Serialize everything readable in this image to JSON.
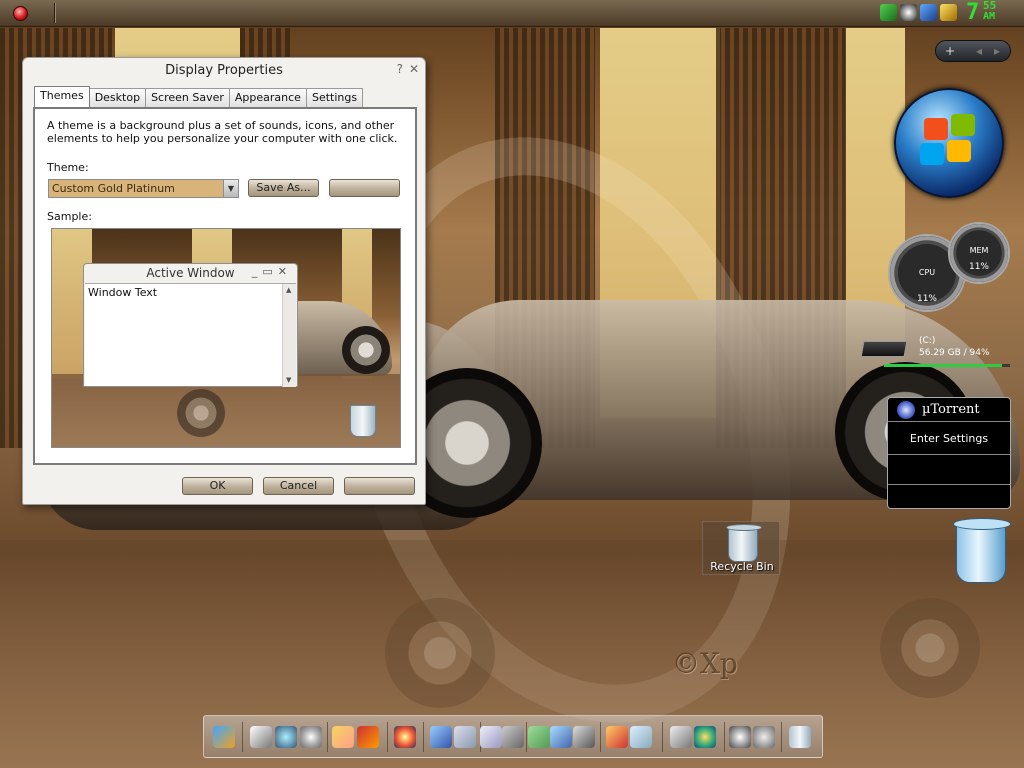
{
  "window": {
    "title": "Display Properties",
    "help": "?",
    "close": "✕"
  },
  "tabs": [
    {
      "label": "Themes"
    },
    {
      "label": "Desktop"
    },
    {
      "label": "Screen Saver"
    },
    {
      "label": "Appearance"
    },
    {
      "label": "Settings"
    }
  ],
  "themes": {
    "description": "A theme is a background plus a set of sounds, icons, and other elements to help you personalize your computer with one click.",
    "theme_label": "Theme:",
    "theme_value": "Custom Gold Platinum",
    "save_as": "Save As...",
    "delete": "",
    "sample_label": "Sample:"
  },
  "preview": {
    "title": "Active Window",
    "controls": "_▭✕",
    "text": "Window Text"
  },
  "footer": {
    "ok": "OK",
    "cancel": "Cancel",
    "apply": ""
  },
  "clock": {
    "hour": "7",
    "minutes": "55",
    "ampm": "AM"
  },
  "sidebar": {
    "pill_add": "+",
    "pill_prev": "◂",
    "pill_next": "▸"
  },
  "gauges": {
    "cpu_label": "CPU",
    "cpu_value": "11%",
    "mem_label": "MEM",
    "mem_value": "11%"
  },
  "drive": {
    "label": "(C:)",
    "stats": "56.29 GB / 94%",
    "used_fraction": 0.94
  },
  "utorrent": {
    "title": "µTorrent",
    "settings": "Enter Settings"
  },
  "desktop": {
    "recycle_bin": "Recycle Bin",
    "watermark": "©Xp"
  },
  "dock_icons": [
    "media-player",
    "calendar",
    "safari",
    "cd",
    "paint",
    "books",
    "firefox",
    "network",
    "files",
    "notepad",
    "tools",
    "mail",
    "display",
    "bugs",
    "media-center",
    "screen",
    "ie",
    "power",
    "back",
    "trash"
  ]
}
